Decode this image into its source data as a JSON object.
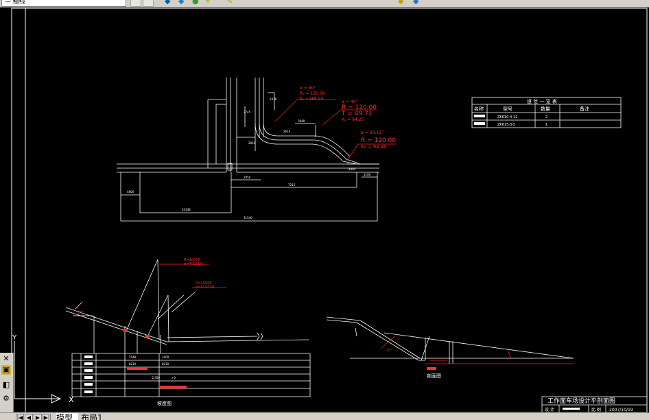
{
  "toolbar": {
    "style_combo": "—  细线",
    "icons": [
      "layer-states-icon",
      "layer-icon",
      "properties-icon",
      "refresh-icon",
      "orbit-icon",
      "match-properties-icon",
      "color-icon"
    ]
  },
  "drawing": {
    "top_labels": {
      "curve1_d": "α = 90°",
      "curve1_r": "R₀ = 120.00",
      "curve1_k": "K₀ =188.50",
      "curve2_d": "α = 45°",
      "curve2_r": "R = 120.00",
      "curve2_t": "T = 49.71",
      "curve2_k": "K₀ = 94.25",
      "curve3_d": "α = 30.15°",
      "curve3_r": "R = 120.00",
      "curve3_k": "K₀ = 94.40"
    },
    "small_dims": {
      "d1": "4800",
      "d2": "2950",
      "d3": "3100",
      "d4": "4900",
      "d5": "2745",
      "d6": "2418",
      "d7": "3848",
      "d8": "2614",
      "d9": "24148",
      "d10": "7215",
      "d11": "2810",
      "d12": "31540",
      "d13": "3450"
    },
    "table": {
      "title": "道 岔 一 览 表",
      "headers": [
        "名称",
        "型号",
        "数量",
        "备注"
      ],
      "rows": [
        {
          "model": "ZK610-4-12",
          "qty": "2",
          "note": ""
        },
        {
          "model": "ZK615-3-5",
          "qty": "1",
          "note": ""
        }
      ]
    },
    "slope_labels": {
      "a1": "R=20000",
      "a1b": "α=4°10′50″",
      "a2": "R=15000",
      "a2b": "α=3°47′10″",
      "angle1": "25°",
      "angle2": "25°"
    },
    "slope_table": {
      "rows": [
        [
          "",
          "2548",
          "1000"
        ],
        [
          "",
          "8210",
          "8210"
        ],
        [
          "",
          "-2.350",
          "+0"
        ],
        [
          "",
          "",
          ""
        ],
        [
          "",
          "",
          ""
        ]
      ]
    },
    "captions": {
      "slope_view": "坡度图",
      "section_view": "剖面图"
    },
    "title_block": {
      "title": "工作面车场设计平剖面图",
      "row_left": "设 计",
      "row_mid": "比 例",
      "row_date": "2007/10/19"
    },
    "ucs": {
      "x": "X",
      "y": "Y"
    }
  },
  "palette": {
    "items": [
      "close-icon",
      "palette-icon",
      "grip-icon",
      "settings-icon"
    ]
  },
  "layout_tabs": {
    "nav_first": "|◀",
    "nav_prev": "◀",
    "nav_next": "▶",
    "nav_last": "▶|",
    "model": "模型",
    "layout1": "布局1"
  }
}
